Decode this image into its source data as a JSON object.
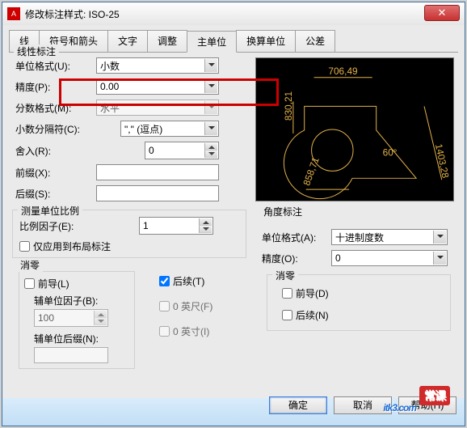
{
  "window": {
    "title": "修改标注样式: ISO-25"
  },
  "tabs": {
    "items": [
      {
        "label": "线"
      },
      {
        "label": "符号和箭头"
      },
      {
        "label": "文字"
      },
      {
        "label": "调整"
      },
      {
        "label": "主单位"
      },
      {
        "label": "换算单位"
      },
      {
        "label": "公差"
      }
    ],
    "active": 4
  },
  "linear": {
    "title": "线性标注",
    "unitFormat_lbl": "单位格式(U):",
    "unitFormat_val": "小数",
    "precision_lbl": "精度(P):",
    "precision_val": "0.00",
    "fractionFormat_lbl": "分数格式(M):",
    "fractionFormat_val": "水平",
    "decimalSep_lbl": "小数分隔符(C):",
    "decimalSep_val": "\",\"",
    "decimalSep_hint": "(逗点)",
    "roundOff_lbl": "舍入(R):",
    "roundOff_val": "0",
    "prefix_lbl": "前缀(X):",
    "prefix_val": "",
    "suffix_lbl": "后缀(S):",
    "suffix_val": ""
  },
  "measureScale": {
    "title": "测量单位比例",
    "scaleFactor_lbl": "比例因子(E):",
    "scaleFactor_val": "1",
    "applyLayout_lbl": "仅应用到布局标注"
  },
  "zeroSup": {
    "title": "消零",
    "leading_lbl": "前导(L)",
    "trailing_lbl": "后续(T)",
    "subFactor_lbl": "辅单位因子(B):",
    "subFactor_val": "100",
    "subSuffix_lbl": "辅单位后缀(N):",
    "subSuffix_val": "",
    "feet_lbl": "0 英尺(F)",
    "inches_lbl": "0 英寸(I)"
  },
  "angular": {
    "title": "角度标注",
    "unitFormat_lbl": "单位格式(A):",
    "unitFormat_val": "十进制度数",
    "precision_lbl": "精度(O):",
    "precision_val": "0",
    "zero_title": "消零",
    "leading_lbl": "前导(D)",
    "trailing_lbl": "后续(N)"
  },
  "preview": {
    "d1": "706,49",
    "d2": "830,21",
    "d3": "858,71",
    "d4": "1403,28",
    "ang": "60°"
  },
  "buttons": {
    "ok": "确定",
    "cancel": "取消",
    "help": "帮助(H)"
  },
  "watermark": {
    "text": "itk3.com",
    "tag": "常课"
  }
}
